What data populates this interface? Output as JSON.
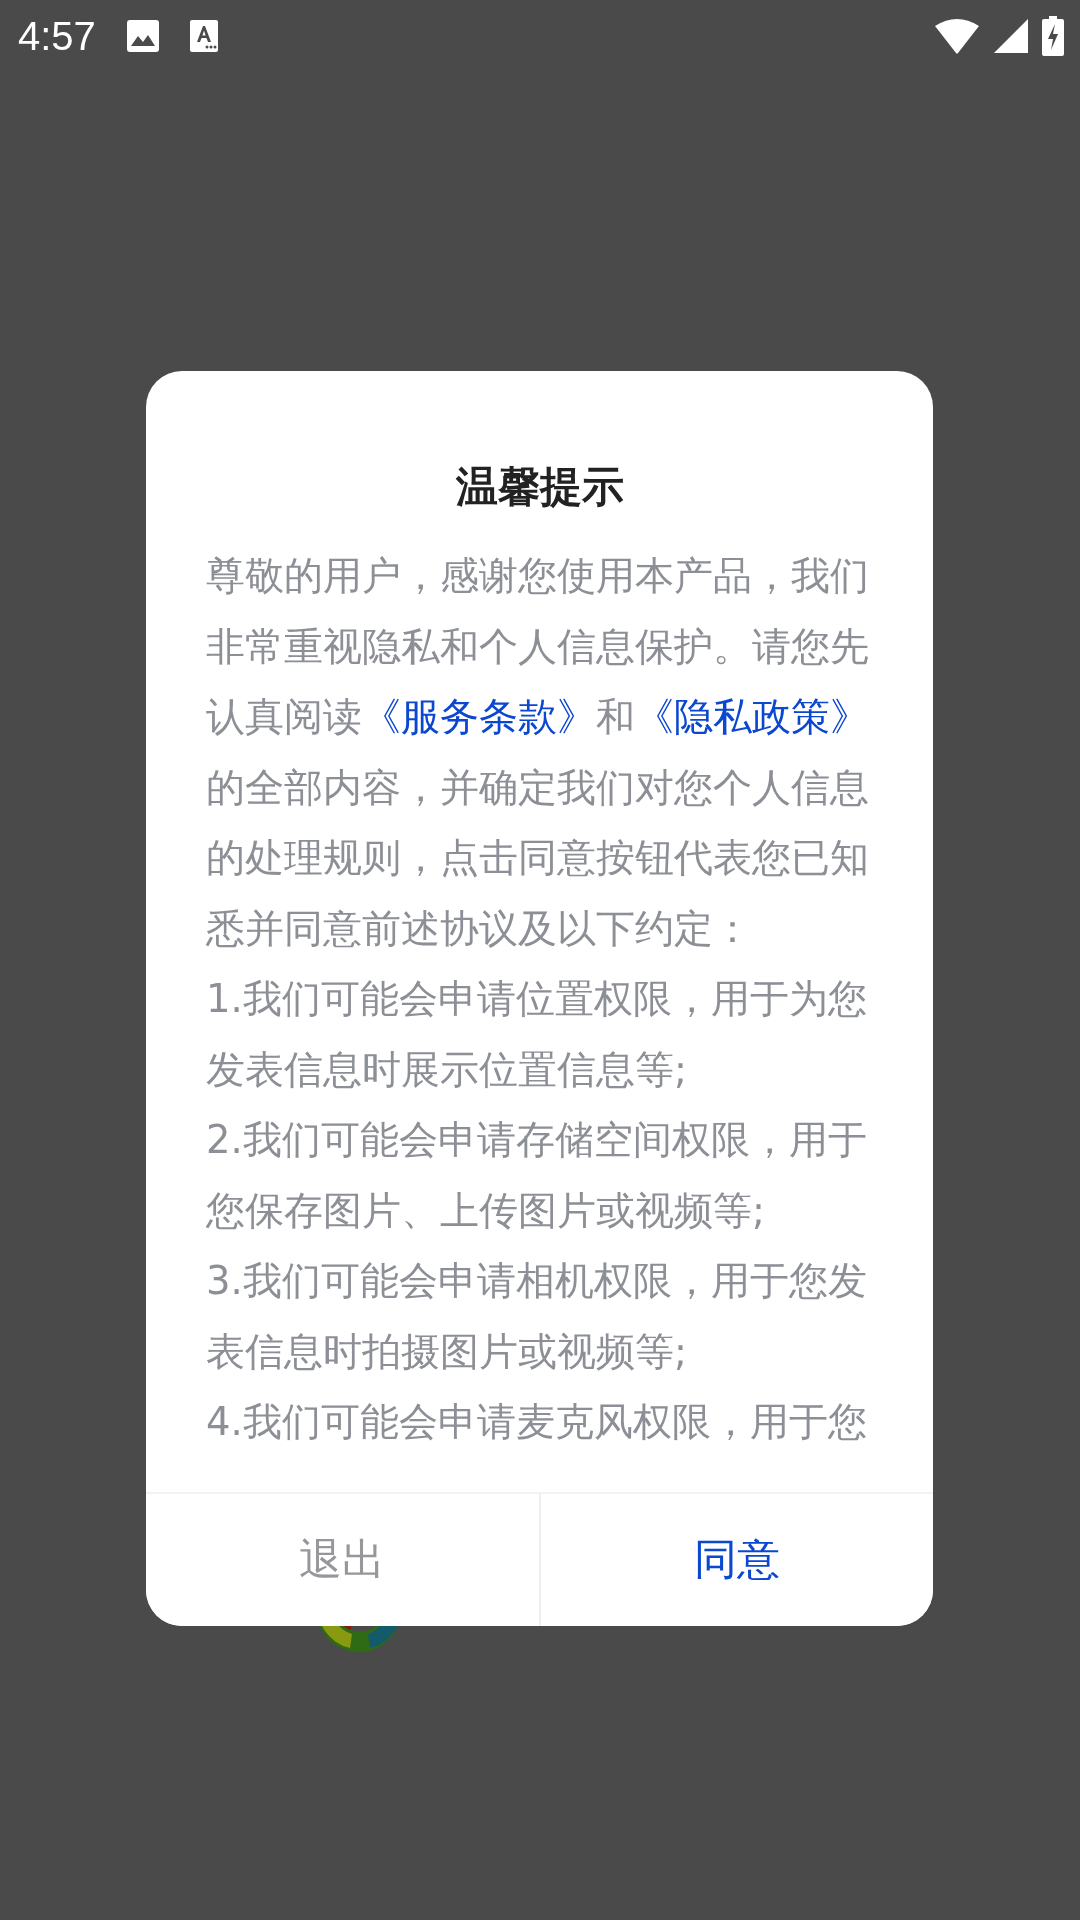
{
  "status_bar": {
    "time": "4:57"
  },
  "dialog": {
    "title": "温馨提示",
    "intro": [
      {
        "kind": "plain",
        "text": "尊敬的用户，感谢您使用本产品，我们非常重视隐私和个人信息保护。请您先认真阅读"
      },
      {
        "kind": "link",
        "text": "《服务条款》"
      },
      {
        "kind": "plain",
        "text": "和"
      },
      {
        "kind": "link",
        "text": "《隐私政策》"
      },
      {
        "kind": "plain",
        "text": "的全部内容，并确定我们对您个人信息的处理规则，点击同意按钮代表您已知悉并同意前述协议及以下约定："
      }
    ],
    "items": [
      "1.我们可能会申请位置权限，用于为您发表信息时展示位置信息等;",
      "2.我们可能会申请存储空间权限，用于您保存图片、上传图片或视频等;",
      "3.我们可能会申请相机权限，用于您发表信息时拍摄图片或视频等;",
      "4.我们可能会申请麦克风权限，用于您"
    ],
    "buttons": [
      {
        "kind": "cancel",
        "label": "退出"
      },
      {
        "kind": "confirm",
        "label": "同意"
      }
    ]
  }
}
